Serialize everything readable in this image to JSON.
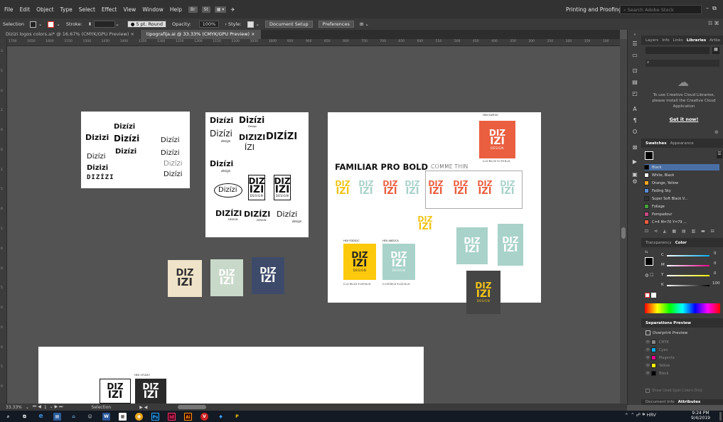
{
  "menu": [
    "File",
    "Edit",
    "Object",
    "Type",
    "Select",
    "Effect",
    "View",
    "Window",
    "Help"
  ],
  "menu_buttons": [
    "Br",
    "St"
  ],
  "workspace": "Printing and Proofing",
  "stock_placeholder": "Search Adobe Stock",
  "controlbar": {
    "selection": "Selection",
    "stroke_label": "Stroke:",
    "brush": "5 pt. Round",
    "opacity_label": "Opacity:",
    "opacity": "100%",
    "style_label": "Style:",
    "doc_setup": "Document Setup",
    "preferences": "Preferences"
  },
  "tabs": [
    {
      "label": "Dizizi logos colors.ai* @ 16.67% (CMYK/GPU Preview)",
      "close": "×"
    },
    {
      "label": "tipografija.ai @ 33.33% (CMYK/GPU Preview)",
      "close": "×"
    }
  ],
  "ruler_h": [
    "1700",
    "1650",
    "1600",
    "1550",
    "1500",
    "1450",
    "1400",
    "1350",
    "1300",
    "1250",
    "1200",
    "1150",
    "1100",
    "1050",
    "1000",
    "950",
    "900",
    "850",
    "800",
    "750",
    "700",
    "650",
    "600",
    "550",
    "500",
    "450",
    "400",
    "350",
    "300",
    "250",
    "200",
    "150",
    "100"
  ],
  "ruler_v": [
    "3",
    "5",
    "0",
    "2",
    "0",
    "0",
    "1",
    "5",
    "0",
    "1",
    "0",
    "0",
    "5",
    "0",
    "0",
    "0",
    "5",
    "0"
  ],
  "artboard1": {
    "words": [
      "Dizízi",
      "Dizizi",
      "Dizízi",
      "Dizízi",
      "Dizízi",
      "Dizízi",
      "Dizízi",
      "Dizízi",
      "Dizizi",
      "Dizízi",
      "DIZÍZI"
    ]
  },
  "artboard2": {
    "words": [
      "Dizízi",
      "Dizízi",
      "Dizízi",
      "DIZIZI",
      "DIZÍZI",
      "ÍZI",
      "Dizízi",
      "Dizízi",
      "DIZÍZI",
      "DIZÍZI",
      "Dizízi"
    ],
    "subs": [
      "Design",
      "design",
      "design",
      "DESIGN",
      "DESIGN",
      "design"
    ]
  },
  "artboard3": {
    "heading": "FAMILIAR PRO BOLD",
    "heading_thin": "COMME THIN",
    "hex_top": "HEX EA5F40",
    "cmyk_top": "C=0 M=72 Y=79 K=0",
    "hex_yellow": "HEX FDD02C",
    "cmyk_yellow": "C=2 M=15 Y=93 K=0",
    "hex_mint": "HEX A8D2CA",
    "cmyk_mint": "C=33 M=0 Y=22 K=0"
  },
  "artboard4": {
    "hex": "HEX 1F1D1Y"
  },
  "mono": {
    "l1": "DIZ",
    "l2": "IZI",
    "sub": "DESIGN"
  },
  "status": {
    "zoom": "33.33%",
    "page": "1",
    "tool": "Selection"
  },
  "panels": {
    "tabs_top": [
      "Layers",
      "Info",
      "Links",
      "Libraries",
      "Artbo"
    ],
    "cc_message": "To use Creative Cloud Libraries, please install the Creative Cloud Application",
    "get_it_now": "Get it now!",
    "swatch_tabs": [
      "Swatches",
      "Appearance"
    ],
    "swatches": [
      {
        "name": "Black",
        "color": "#000000"
      },
      {
        "name": "White, Black",
        "color": "#ffffff"
      },
      {
        "name": "Orange, Yellow",
        "color": "#f5a623"
      },
      {
        "name": "Fading Sky",
        "color": "#5b8ed6"
      },
      {
        "name": "Super Soft Black V...",
        "color": "#333333"
      },
      {
        "name": "Foliage",
        "color": "#4a9c3d"
      },
      {
        "name": "Pompadour",
        "color": "#c24b82"
      },
      {
        "name": "C=4 M=70 Y=79 ...",
        "color": "#ea5f40"
      }
    ],
    "color_tabs": [
      "Transparency",
      "Color"
    ],
    "cmyk_labels": [
      "C",
      "M",
      "Y",
      "K"
    ],
    "cmyk_values": [
      "0",
      "0",
      "0",
      "100"
    ],
    "sep_title": "Separations Preview",
    "overprint": "Overprint Preview",
    "sep_rows": [
      "CMYK",
      "Cyan",
      "Magenta",
      "Yellow",
      "Black"
    ],
    "spot_only": "Show Used Spot Colors Only",
    "bottom_tabs": [
      "Document Info",
      "Attributes"
    ]
  },
  "taskbar": {
    "lang": "HRV",
    "time": "9:24 PM",
    "date": "9/4/2019"
  }
}
